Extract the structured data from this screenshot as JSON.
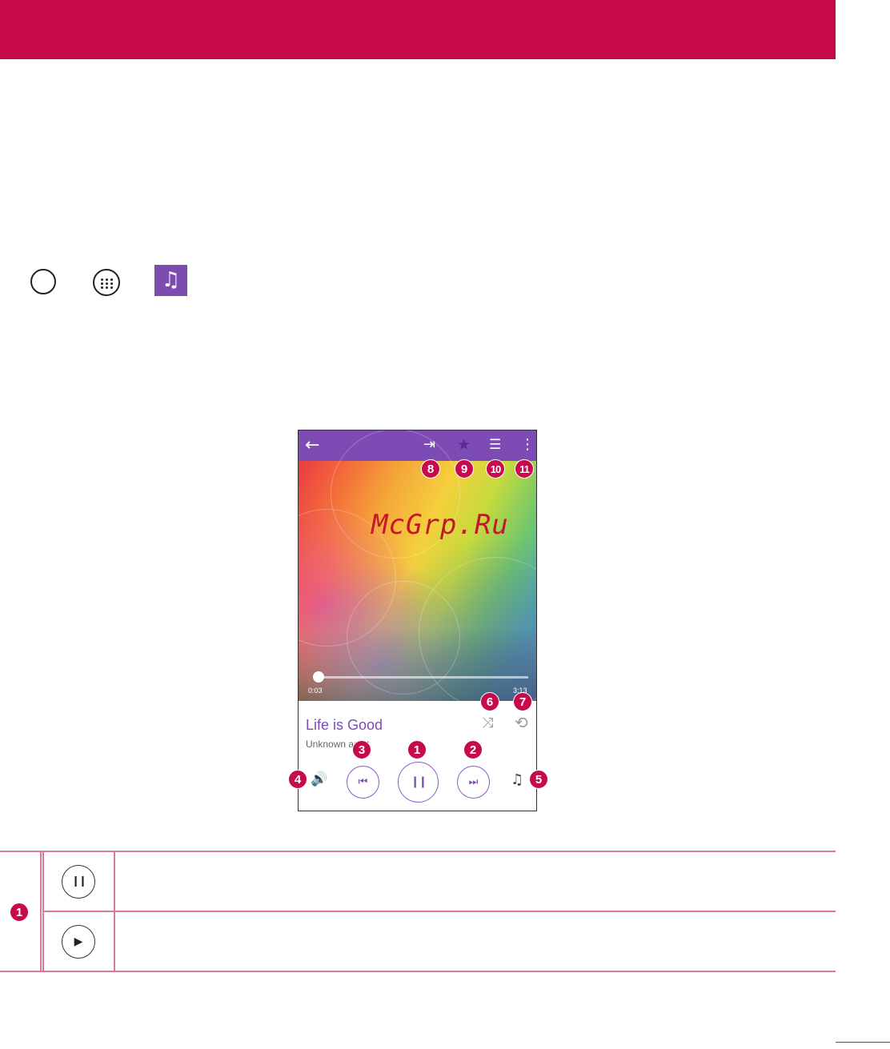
{
  "document": {
    "header_color": "#c70a4c",
    "watermark": "McGrp.Ru",
    "nav_icons": [
      "home-icon",
      "apps-icon",
      "music-app-icon"
    ]
  },
  "player": {
    "appbar_color": "#7d4bb4",
    "song_title": "Life is Good",
    "artist": "Unknown artist",
    "elapsed_time": "0:03",
    "total_time": "3:13",
    "progress_fraction": 0.02,
    "icons": {
      "back": "←",
      "output": "⇥",
      "favorite": "★",
      "playlist": "☰",
      "more": "⋮",
      "shuffle": "⤨",
      "repeat": "⟲",
      "volume": "🔊",
      "prev": "⏮",
      "pause": "❙❙",
      "next": "⏭",
      "lyrics": "♫"
    }
  },
  "callouts": [
    "1",
    "2",
    "3",
    "4",
    "5",
    "6",
    "7",
    "8",
    "9",
    "10",
    "11"
  ],
  "table": {
    "row_number": "1",
    "rows": [
      {
        "icon": "pause-icon",
        "glyph": "❙❙"
      },
      {
        "icon": "play-icon",
        "glyph": "▶"
      }
    ]
  }
}
